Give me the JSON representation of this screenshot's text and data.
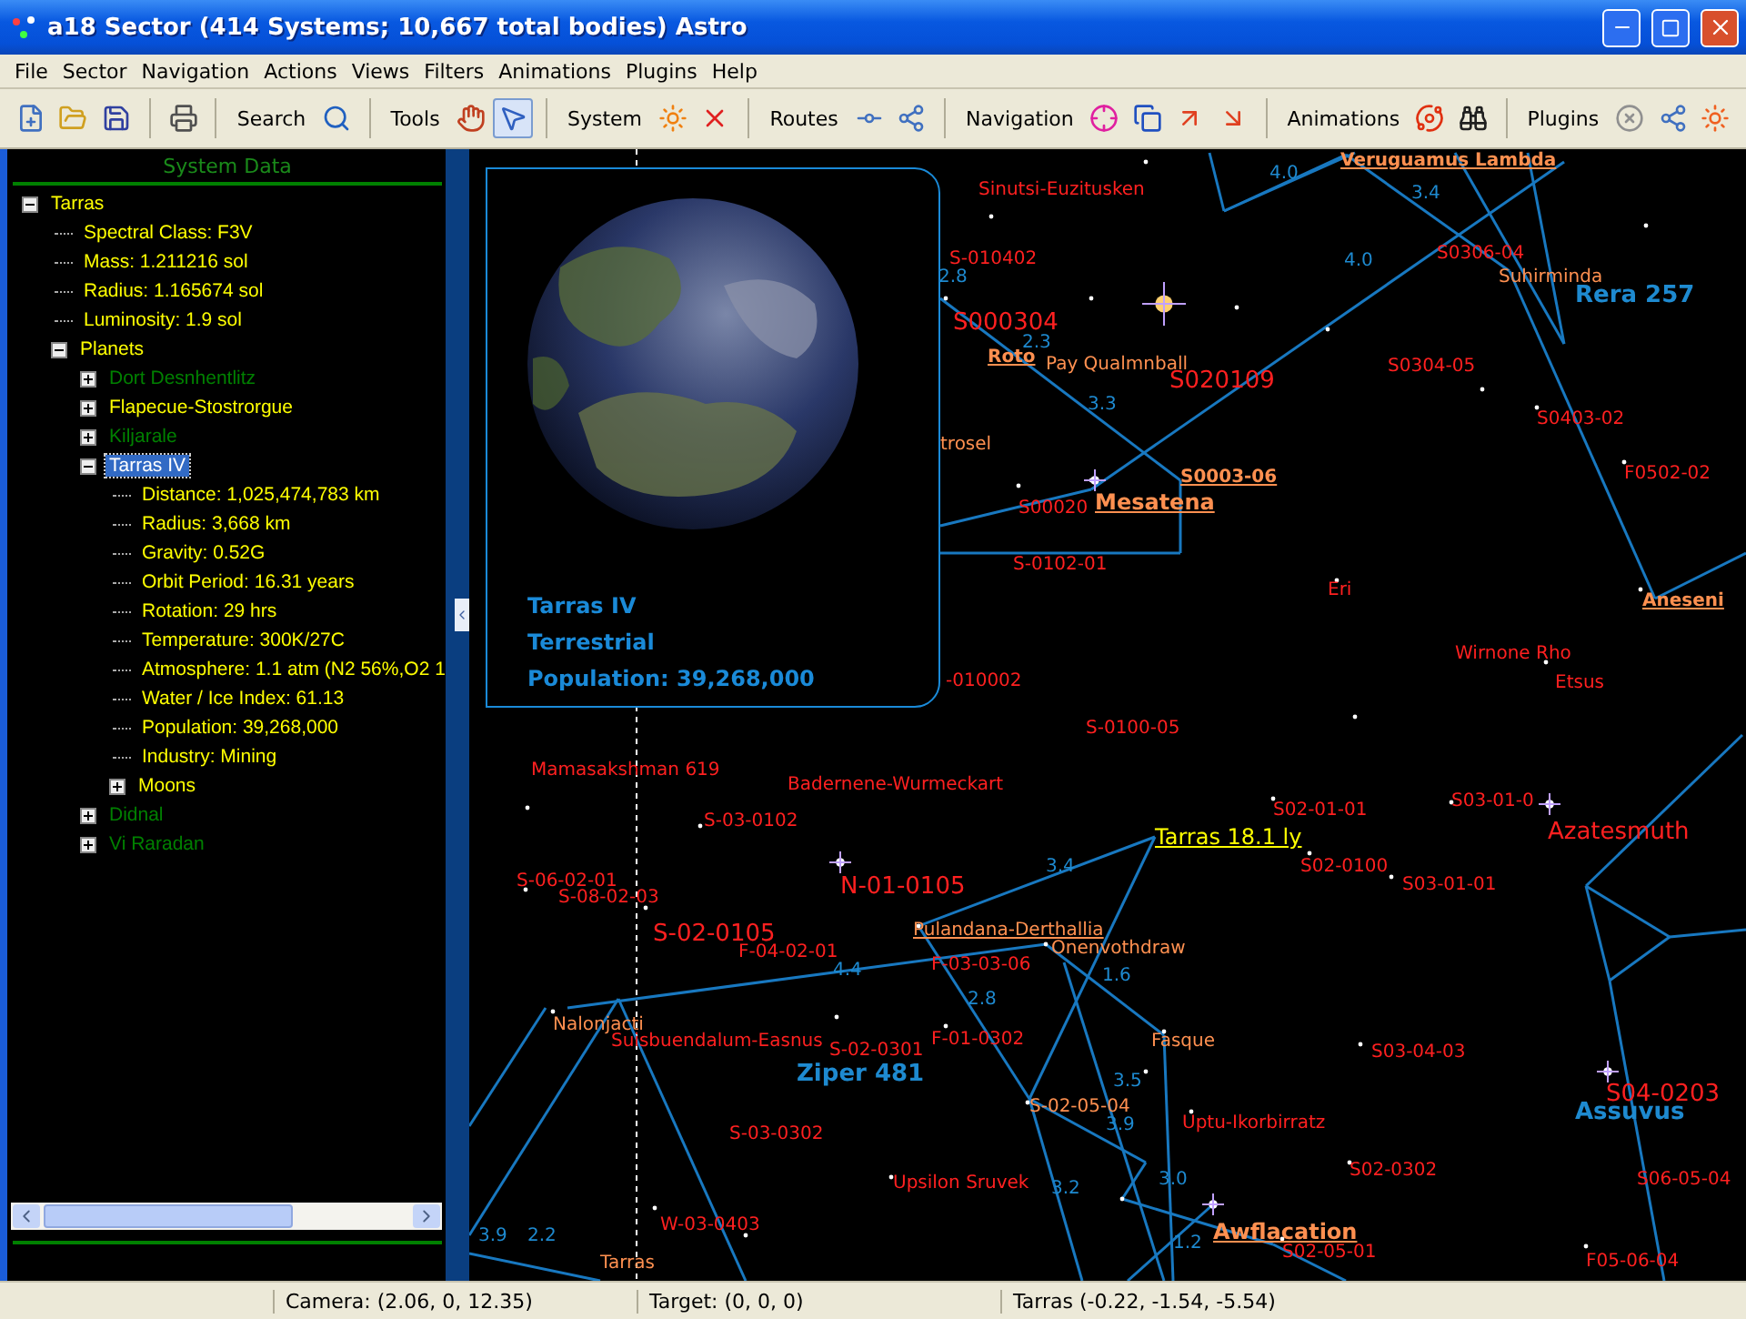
{
  "window": {
    "title": "a18 Sector (414 Systems; 10,667 total bodies) Astro"
  },
  "menu": [
    "File",
    "Sector",
    "Navigation",
    "Actions",
    "Views",
    "Filters",
    "Animations",
    "Plugins",
    "Help"
  ],
  "toolbar": {
    "groups": [
      {
        "label": "Search"
      },
      {
        "label": "Tools",
        "buttons": [
          {
            "selected": false
          },
          {
            "selected": true
          }
        ]
      },
      {
        "label": "System"
      },
      {
        "label": "Routes"
      },
      {
        "label": "Navigation"
      },
      {
        "label": "Animations"
      },
      {
        "label": "Plugins"
      }
    ]
  },
  "system_panel": {
    "title": "System Data",
    "tree": [
      {
        "label": "Tarras",
        "expanded": true,
        "selected": false,
        "children": [
          {
            "label": "Spectral Class: F3V",
            "selected": false
          },
          {
            "label": "Mass: 1.211216 sol",
            "selected": false
          },
          {
            "label": "Radius: 1.165674 sol",
            "selected": false
          },
          {
            "label": "Luminosity: 1.9 sol",
            "selected": false
          },
          {
            "label": "Planets",
            "expanded": true,
            "selected": false,
            "children": [
              {
                "label": "Dort Desnhentlitz",
                "expanded": false,
                "selected": false,
                "color": "#008000"
              },
              {
                "label": "Flapecue-Stostrorgue",
                "expanded": false,
                "selected": false,
                "color": "#ffff00"
              },
              {
                "label": "Kiljarale",
                "expanded": false,
                "selected": false,
                "color": "#008000"
              },
              {
                "label": "Tarras IV",
                "expanded": true,
                "selected": true,
                "children": [
                  {
                    "label": "Distance: 1,025,474,783 km",
                    "selected": false
                  },
                  {
                    "label": "Radius: 3,668 km",
                    "selected": false
                  },
                  {
                    "label": "Gravity: 0.52G",
                    "selected": false
                  },
                  {
                    "label": "Orbit Period: 16.31 years",
                    "selected": false
                  },
                  {
                    "label": "Rotation: 29 hrs",
                    "selected": false
                  },
                  {
                    "label": "Temperature: 300K/27C",
                    "selected": false
                  },
                  {
                    "label": "Atmosphere: 1.1 atm (N2 56%,O2 1",
                    "selected": false
                  },
                  {
                    "label": "Water / Ice Index: 61.13",
                    "selected": false
                  },
                  {
                    "label": "Population: 39,268,000",
                    "selected": false
                  },
                  {
                    "label": "Industry: Mining",
                    "selected": false
                  },
                  {
                    "label": "Moons",
                    "expanded": false,
                    "selected": false
                  }
                ]
              },
              {
                "label": "Didnal",
                "expanded": false,
                "selected": false,
                "color": "#008000"
              },
              {
                "label": "Vi Raradan",
                "expanded": false,
                "selected": false,
                "color": "#008000"
              }
            ]
          }
        ]
      }
    ]
  },
  "planet_popup": {
    "name": "Tarras IV",
    "type": "Terrestrial",
    "population": "Population: 39,268,000"
  },
  "map_labels": [
    {
      "text": "Sinutsi-Euzitusken",
      "kind": "star"
    },
    {
      "text": "Veruguamus Lambda",
      "kind": "link"
    },
    {
      "text": "4.0",
      "kind": "distance"
    },
    {
      "text": "3.4",
      "kind": "distance"
    },
    {
      "text": "S-010402",
      "kind": "star"
    },
    {
      "text": "2.8",
      "kind": "distance"
    },
    {
      "text": "S0306-04",
      "kind": "star"
    },
    {
      "text": "Suhirminda",
      "kind": "named"
    },
    {
      "text": "Rera 257",
      "kind": "region"
    },
    {
      "text": "4.0",
      "kind": "distance"
    },
    {
      "text": "S000304",
      "kind": "star_large"
    },
    {
      "text": "Roto",
      "kind": "link"
    },
    {
      "text": "Pay Qualmnball",
      "kind": "named"
    },
    {
      "text": "2.3",
      "kind": "distance"
    },
    {
      "text": "S020109",
      "kind": "star_large"
    },
    {
      "text": "S0304-05",
      "kind": "star"
    },
    {
      "text": "3.3",
      "kind": "distance"
    },
    {
      "text": "S0403-02",
      "kind": "star"
    },
    {
      "text": "F0502-02",
      "kind": "star"
    },
    {
      "text": "trosel",
      "kind": "named"
    },
    {
      "text": "S0003-06",
      "kind": "link"
    },
    {
      "text": "S00020",
      "kind": "star"
    },
    {
      "text": "Mesatena",
      "kind": "link_large"
    },
    {
      "text": "S-0102-01",
      "kind": "star"
    },
    {
      "text": "Eri",
      "kind": "star"
    },
    {
      "text": "Aneseni",
      "kind": "link"
    },
    {
      "text": "Wirnone Rho",
      "kind": "star"
    },
    {
      "text": "Etsus",
      "kind": "star"
    },
    {
      "text": "-010002",
      "kind": "star"
    },
    {
      "text": "S-0100-05",
      "kind": "star"
    },
    {
      "text": "Mamasakshman 619",
      "kind": "star"
    },
    {
      "text": "Badernene-Wurmeckart",
      "kind": "star"
    },
    {
      "text": "S02-01-01",
      "kind": "star"
    },
    {
      "text": "S03-01-0",
      "kind": "star"
    },
    {
      "text": "S-03-0102",
      "kind": "star"
    },
    {
      "text": "Tarras 18.1 ly",
      "kind": "current"
    },
    {
      "text": "Azatesmuth",
      "kind": "star_large"
    },
    {
      "text": "S-06-02-01",
      "kind": "star"
    },
    {
      "text": "3.4",
      "kind": "distance"
    },
    {
      "text": "N-01-0105",
      "kind": "star_large"
    },
    {
      "text": "S02-0100",
      "kind": "star"
    },
    {
      "text": "S03-01-01",
      "kind": "star"
    },
    {
      "text": "S-08-02-03",
      "kind": "star"
    },
    {
      "text": "S-02-0105",
      "kind": "star_large"
    },
    {
      "text": "Pulandana-Derthallia",
      "kind": "link_plain"
    },
    {
      "text": "F-04-02-01",
      "kind": "star"
    },
    {
      "text": "Onenvothdraw",
      "kind": "named"
    },
    {
      "text": "4.4",
      "kind": "distance"
    },
    {
      "text": "F-03-03-06",
      "kind": "star"
    },
    {
      "text": "1.6",
      "kind": "distance"
    },
    {
      "text": "2.8",
      "kind": "distance"
    },
    {
      "text": "Nalonjacti",
      "kind": "named"
    },
    {
      "text": "Suisbuendalum-Easnus",
      "kind": "star"
    },
    {
      "text": "S-02-0301",
      "kind": "star"
    },
    {
      "text": "F-01-0302",
      "kind": "star"
    },
    {
      "text": "Fasque",
      "kind": "named"
    },
    {
      "text": "Ziper 481",
      "kind": "region"
    },
    {
      "text": "S03-04-03",
      "kind": "star"
    },
    {
      "text": "S04-0203",
      "kind": "star_large"
    },
    {
      "text": "Assuvus",
      "kind": "region"
    },
    {
      "text": "3.5",
      "kind": "distance"
    },
    {
      "text": "S-02-05-04",
      "kind": "named"
    },
    {
      "text": "3.9",
      "kind": "distance"
    },
    {
      "text": "S-03-0302",
      "kind": "star"
    },
    {
      "text": "Uptu-Ikorbirratz",
      "kind": "star"
    },
    {
      "text": "Upsilon Sruvek",
      "kind": "star"
    },
    {
      "text": "3.2",
      "kind": "distance"
    },
    {
      "text": "3.0",
      "kind": "distance"
    },
    {
      "text": "S02-0302",
      "kind": "star"
    },
    {
      "text": "S06-05-04",
      "kind": "star"
    },
    {
      "text": "3.9",
      "kind": "distance"
    },
    {
      "text": "2.2",
      "kind": "distance"
    },
    {
      "text": "W-03-0403",
      "kind": "star"
    },
    {
      "text": "1.2",
      "kind": "distance"
    },
    {
      "text": "Awflacation",
      "kind": "link_large"
    },
    {
      "text": "Tarras",
      "kind": "named"
    },
    {
      "text": "S02-05-01",
      "kind": "star"
    },
    {
      "text": "F05-06-04",
      "kind": "star"
    }
  ],
  "status_bar": [
    "Camera: (2.06, 0, 12.35)",
    "Target: (0, 0, 0)",
    "Tarras (-0.22, -1.54, -5.54)"
  ]
}
